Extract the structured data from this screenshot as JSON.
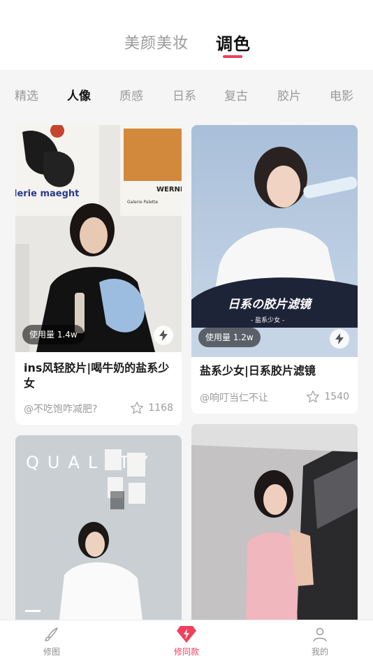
{
  "mode_tabs": [
    {
      "label": "美颜美妆",
      "active": false
    },
    {
      "label": "调色",
      "active": true
    }
  ],
  "category_tabs": [
    "精选",
    "人像",
    "质感",
    "日系",
    "复古",
    "胶片",
    "电影"
  ],
  "active_category": "人像",
  "cards": [
    {
      "usage": "使用量 1.4w",
      "title": "ins风轻胶片|喝牛奶的盐系少女",
      "author": "@不吃饱咋减肥?",
      "likes": "1168",
      "poster_text_1": "lerie maeght",
      "poster_text_2": "WERNE",
      "poster_text_3": "Galerie Palette"
    },
    {
      "usage": "使用量 1.2w",
      "title": "盐系少女|日系胶片滤镜",
      "author": "@响叮当仁不让",
      "likes": "1540",
      "overlay_title": "日系の胶片滤镜",
      "overlay_sub": "- 盐系少女 -"
    },
    {
      "overlay_text": "QUALITY"
    },
    {}
  ],
  "bottom_nav": [
    {
      "label": "修图",
      "icon": "brush-icon",
      "active": false
    },
    {
      "label": "修同款",
      "icon": "diamond-bolt-icon",
      "active": true
    },
    {
      "label": "我的",
      "icon": "user-icon",
      "active": false
    }
  ],
  "colors": {
    "accent": "#f0405e",
    "background": "#f5f5f6"
  }
}
